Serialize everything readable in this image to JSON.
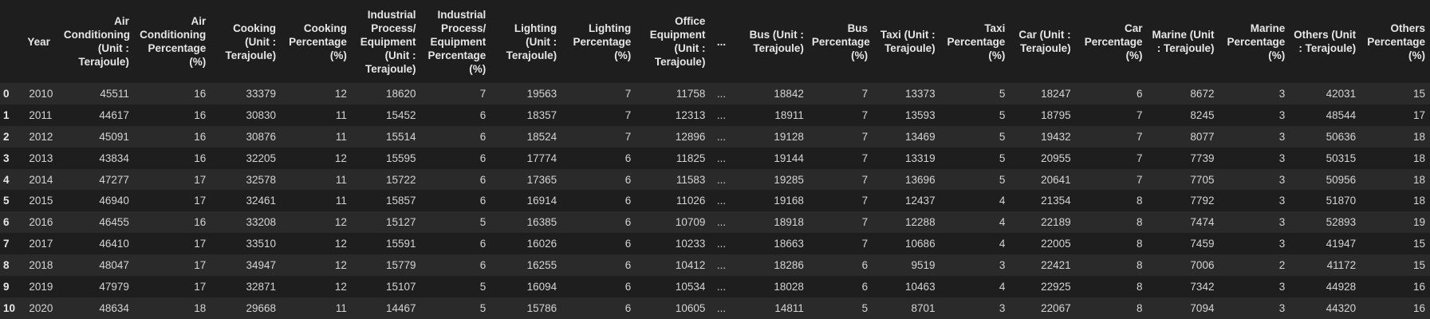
{
  "table": {
    "index_header": "",
    "columns": [
      "Year",
      "Air Conditioning (Unit : Terajoule)",
      "Air Conditioning Percentage (%)",
      "Cooking (Unit : Terajoule)",
      "Cooking Percentage (%)",
      "Industrial Process/ Equipment (Unit : Terajoule)",
      "Industrial Process/ Equipment Percentage (%)",
      "Lighting (Unit : Terajoule)",
      "Lighting Percentage (%)",
      "Office Equipment (Unit : Terajoule)",
      "...",
      "Bus (Unit : Terajoule)",
      "Bus Percentage (%)",
      "Taxi (Unit : Terajoule)",
      "Taxi Percentage (%)",
      "Car (Unit : Terajoule)",
      "Car Percentage (%)",
      "Marine (Unit : Terajoule)",
      "Marine Percentage (%)",
      "Others (Unit : Terajoule)",
      "Others Percentage (%)"
    ],
    "rows": [
      {
        "index": "0",
        "cells": [
          "2010",
          "45511",
          "16",
          "33379",
          "12",
          "18620",
          "7",
          "19563",
          "7",
          "11758",
          "...",
          "18842",
          "7",
          "13373",
          "5",
          "18247",
          "6",
          "8672",
          "3",
          "42031",
          "15"
        ]
      },
      {
        "index": "1",
        "cells": [
          "2011",
          "44617",
          "16",
          "30830",
          "11",
          "15452",
          "6",
          "18357",
          "7",
          "12313",
          "...",
          "18911",
          "7",
          "13593",
          "5",
          "18795",
          "7",
          "8245",
          "3",
          "48544",
          "17"
        ]
      },
      {
        "index": "2",
        "cells": [
          "2012",
          "45091",
          "16",
          "30876",
          "11",
          "15514",
          "6",
          "18524",
          "7",
          "12896",
          "...",
          "19128",
          "7",
          "13469",
          "5",
          "19432",
          "7",
          "8077",
          "3",
          "50636",
          "18"
        ]
      },
      {
        "index": "3",
        "cells": [
          "2013",
          "43834",
          "16",
          "32205",
          "12",
          "15595",
          "6",
          "17774",
          "6",
          "11825",
          "...",
          "19144",
          "7",
          "13319",
          "5",
          "20955",
          "7",
          "7739",
          "3",
          "50315",
          "18"
        ]
      },
      {
        "index": "4",
        "cells": [
          "2014",
          "47277",
          "17",
          "32578",
          "11",
          "15722",
          "6",
          "17365",
          "6",
          "11583",
          "...",
          "19285",
          "7",
          "13696",
          "5",
          "20641",
          "7",
          "7705",
          "3",
          "50956",
          "18"
        ]
      },
      {
        "index": "5",
        "cells": [
          "2015",
          "46940",
          "17",
          "32461",
          "11",
          "15857",
          "6",
          "16914",
          "6",
          "11026",
          "...",
          "19168",
          "7",
          "12437",
          "4",
          "21354",
          "8",
          "7792",
          "3",
          "51870",
          "18"
        ]
      },
      {
        "index": "6",
        "cells": [
          "2016",
          "46455",
          "16",
          "33208",
          "12",
          "15127",
          "5",
          "16385",
          "6",
          "10709",
          "...",
          "18918",
          "7",
          "12288",
          "4",
          "22189",
          "8",
          "7474",
          "3",
          "52893",
          "19"
        ]
      },
      {
        "index": "7",
        "cells": [
          "2017",
          "46410",
          "17",
          "33510",
          "12",
          "15591",
          "6",
          "16026",
          "6",
          "10233",
          "...",
          "18663",
          "7",
          "10686",
          "4",
          "22005",
          "8",
          "7459",
          "3",
          "41947",
          "15"
        ]
      },
      {
        "index": "8",
        "cells": [
          "2018",
          "48047",
          "17",
          "34947",
          "12",
          "15779",
          "6",
          "16255",
          "6",
          "10412",
          "...",
          "18286",
          "6",
          "9519",
          "3",
          "22421",
          "8",
          "7006",
          "2",
          "41172",
          "15"
        ]
      },
      {
        "index": "9",
        "cells": [
          "2019",
          "47979",
          "17",
          "32871",
          "12",
          "15107",
          "5",
          "16094",
          "6",
          "10534",
          "...",
          "18028",
          "6",
          "10463",
          "4",
          "22925",
          "8",
          "7342",
          "3",
          "44928",
          "16"
        ]
      },
      {
        "index": "10",
        "cells": [
          "2020",
          "48634",
          "18",
          "29668",
          "11",
          "14467",
          "5",
          "15786",
          "6",
          "10605",
          "...",
          "14811",
          "5",
          "8701",
          "3",
          "22067",
          "8",
          "7094",
          "3",
          "44320",
          "16"
        ]
      }
    ]
  }
}
